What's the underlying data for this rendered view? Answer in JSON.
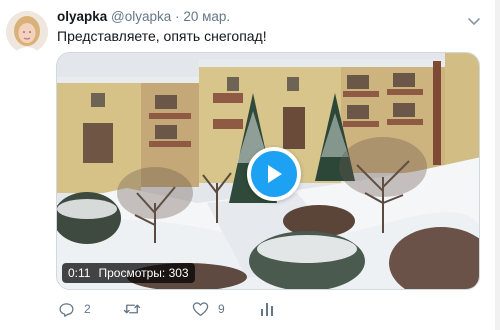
{
  "tweet": {
    "author": {
      "name": "olyapka",
      "handle": "@olyapka",
      "separator": "·",
      "date": "20 мар."
    },
    "text": "Представляете, опять снегопад!",
    "media": {
      "duration": "0:11",
      "views": "Просмотры: 303"
    },
    "actions": {
      "replies": "2",
      "retweets": "",
      "likes": "9"
    }
  },
  "icons": {
    "menu": "chevron-down-icon",
    "reply": "reply-icon",
    "retweet": "retweet-icon",
    "like": "heart-icon",
    "analytics": "analytics-icon",
    "play": "play-icon"
  },
  "colors": {
    "accent": "#1da1f2",
    "muted": "#657786",
    "text": "#14171a"
  }
}
